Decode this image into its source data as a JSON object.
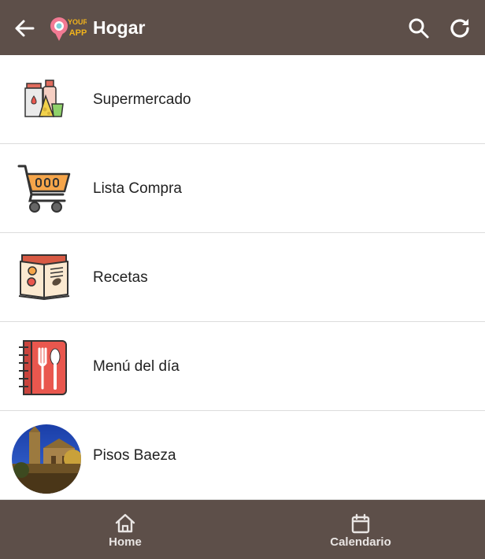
{
  "header": {
    "title": "Hogar",
    "logo_text": "YOUR APP"
  },
  "items": [
    {
      "label": "Supermercado",
      "icon": "groceries-icon"
    },
    {
      "label": "Lista Compra",
      "icon": "shopping-cart-icon"
    },
    {
      "label": "Recetas",
      "icon": "recipe-book-icon"
    },
    {
      "label": "Menú del día",
      "icon": "menu-notebook-icon"
    },
    {
      "label": "Pisos Baeza",
      "icon": "baeza-photo"
    }
  ],
  "bottom_nav": {
    "home_label": "Home",
    "calendar_label": "Calendario"
  },
  "colors": {
    "bar": "#5d4f49",
    "accent_orange": "#f5a54a",
    "accent_red": "#e9574e"
  }
}
